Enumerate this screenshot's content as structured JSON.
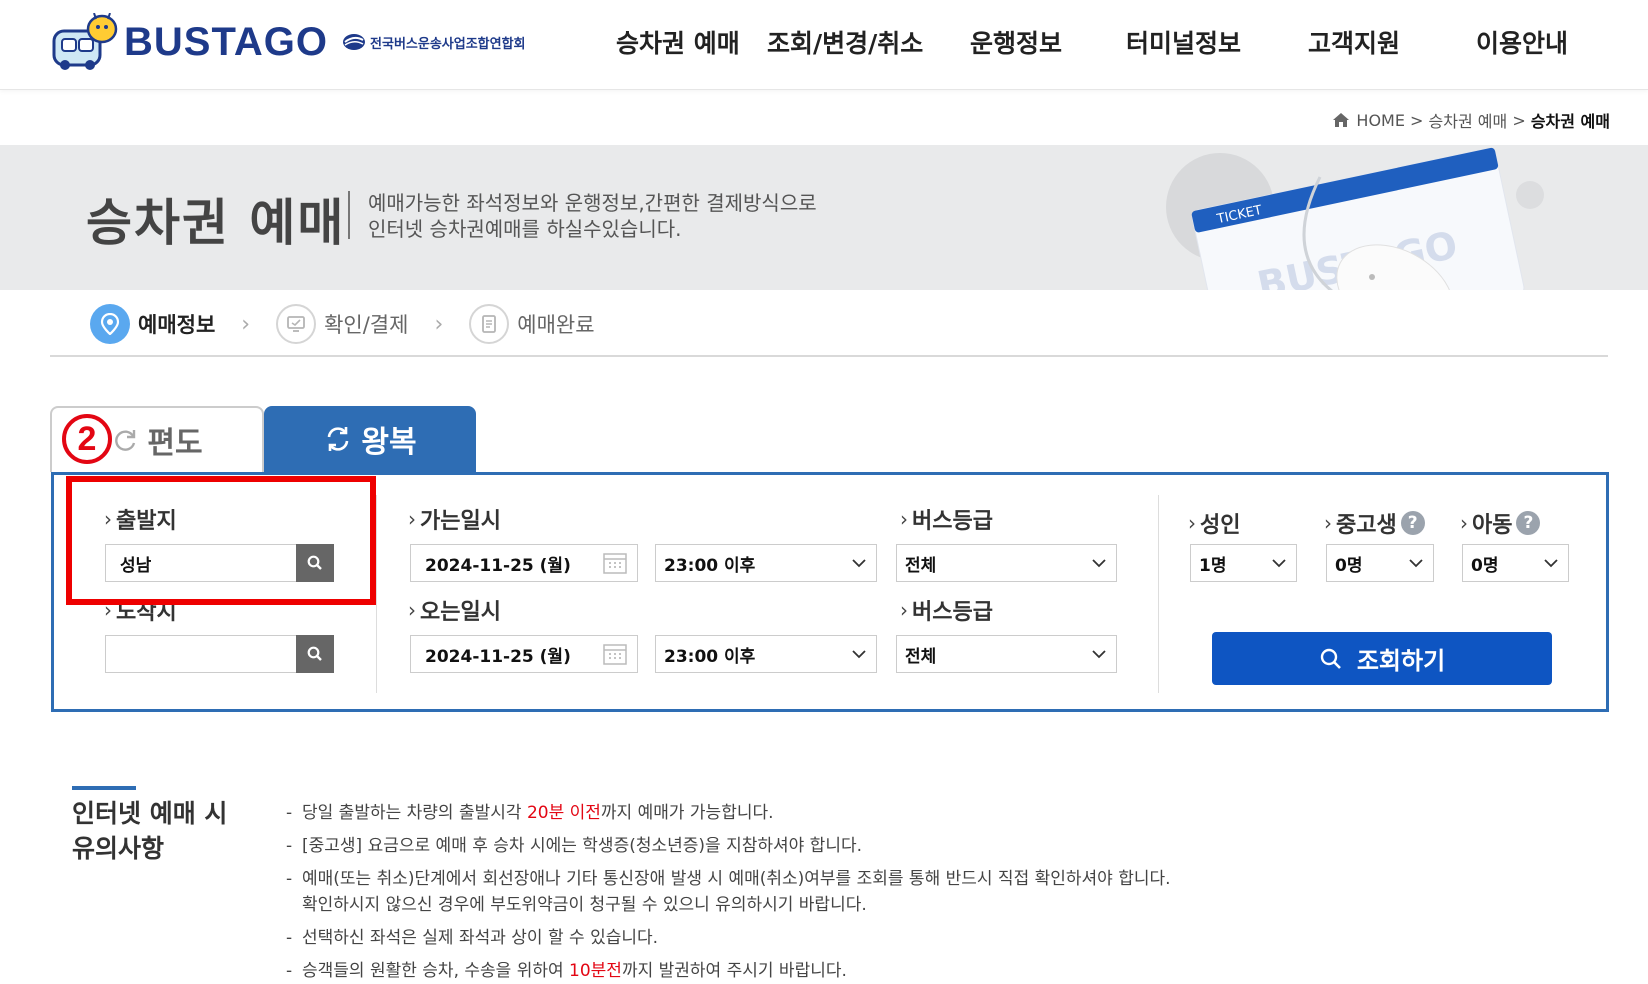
{
  "header": {
    "logo_text": "BUSTAGO",
    "association": "전국버스운송사업조합연합회",
    "nav": [
      {
        "label": "승차권 예매"
      },
      {
        "label": "조회/변경/취소"
      },
      {
        "label": "운행정보"
      },
      {
        "label": "터미널정보"
      },
      {
        "label": "고객지원"
      },
      {
        "label": "이용안내"
      }
    ]
  },
  "breadcrumb": {
    "home": "HOME",
    "sep1": ">",
    "section": "승차권 예매",
    "sep2": ">",
    "current": "승차권 예매"
  },
  "hero": {
    "title": "승차권 예매",
    "desc_line1": "예매가능한 좌석정보와 운행정보,간편한 결제방식으로",
    "desc_line2": "인터넷 승차권예매를 하실수있습니다.",
    "ticket_text": "TICKET",
    "card_text": "BUSTAGO"
  },
  "steps": [
    {
      "label": "예매정보",
      "active": true
    },
    {
      "label": "확인/결제",
      "active": false
    },
    {
      "label": "예매완료",
      "active": false
    }
  ],
  "tabs": {
    "oneway": "편도",
    "roundtrip": "왕복"
  },
  "marker": "2",
  "form": {
    "departure_label": "출발지",
    "departure_value": "성남",
    "arrival_label": "도착지",
    "arrival_value": "",
    "go_date_label": "가는일시",
    "go_date_value": "2024-11-25 (월)",
    "go_time_value": "23:00 이후",
    "go_grade_label": "버스등급",
    "go_grade_value": "전체",
    "return_date_label": "오는일시",
    "return_date_value": "2024-11-25 (월)",
    "return_time_value": "23:00 이후",
    "return_grade_label": "버스등급",
    "return_grade_value": "전체",
    "adult_label": "성인",
    "adult_value": "1명",
    "student_label": "중고생",
    "student_value": "0명",
    "child_label": "아동",
    "child_value": "0명",
    "search_button": "조회하기"
  },
  "notes": {
    "title_line1": "인터넷 예매 시",
    "title_line2": "유의사항",
    "items": [
      {
        "pre": "당일 출발하는 차량의 출발시각 ",
        "red": "20분 이전",
        "post": "까지 예매가 가능합니다."
      },
      {
        "text": "[중고생] 요금으로 예매 후 승차 시에는 학생증(청소년증)을 지참하셔야 합니다."
      },
      {
        "line1": "예매(또는 취소)단계에서 회선장애나 기타 통신장애 발생 시 예매(취소)여부를 조회를 통해 반드시 직접 확인하셔야 합니다.",
        "line2": "확인하시지 않으신 경우에 부도위약금이 청구될 수 있으니 유의하시기 바랍니다."
      },
      {
        "text": "선택하신 좌석은 실제 좌석과 상이 할 수 있습니다."
      },
      {
        "pre": "승객들의 원활한 승차, 수송을 위하여 ",
        "red": "10분전",
        "post": "까지 발권하여 주시기 바랍니다."
      }
    ]
  },
  "colors": {
    "brand_blue": "#2e6db4",
    "button_blue": "#0e55c2",
    "highlight_red": "#ee0000"
  }
}
